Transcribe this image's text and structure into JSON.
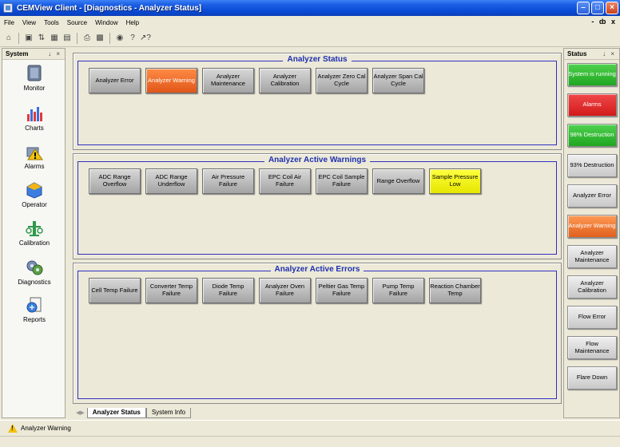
{
  "window": {
    "title": "CEMView Client - [Diagnostics - Analyzer Status]",
    "controls": [
      "minimize",
      "maximize",
      "close"
    ]
  },
  "menu": {
    "items": [
      "File",
      "View",
      "Tools",
      "Source",
      "Window",
      "Help"
    ],
    "mdi_controls": "- ȸ x"
  },
  "toolbar": {
    "icons": [
      "home-icon",
      "window-icon",
      "sort-icon",
      "grid-icon",
      "grid-alt-icon",
      "printer-icon",
      "chart-icon",
      "binoculars-icon",
      "help-icon",
      "whats-this-icon"
    ]
  },
  "system_panel": {
    "title": "System",
    "pin": "↓ ×",
    "items": [
      {
        "label": "Monitor",
        "icon": "monitor-icon"
      },
      {
        "label": "Charts",
        "icon": "charts-icon"
      },
      {
        "label": "Alarms",
        "icon": "alarms-icon"
      },
      {
        "label": "Operator",
        "icon": "operator-icon"
      },
      {
        "label": "Calibration",
        "icon": "calibration-icon"
      },
      {
        "label": "Diagnostics",
        "icon": "diagnostics-icon"
      },
      {
        "label": "Reports",
        "icon": "reports-icon"
      }
    ]
  },
  "status_panel": {
    "title": "Status",
    "pin": "↓ ×",
    "items": [
      {
        "label": "System is running",
        "color": "#2fb82f"
      },
      {
        "label": "Alarms",
        "color": "#e02424"
      },
      {
        "label": "98% Destruction",
        "color": "#2fb82f"
      },
      {
        "label": "93% Destruction",
        "color": "#d8d8d8"
      },
      {
        "label": "Analyzer Error",
        "color": "#d8d8d8"
      },
      {
        "label": "Analyzer Warning",
        "color": "#f07030"
      },
      {
        "label": "Analyzer Maintenance",
        "color": "#d8d8d8"
      },
      {
        "label": "Analyzer Calibration",
        "color": "#d8d8d8"
      },
      {
        "label": "Flow Error",
        "color": "#d8d8d8"
      },
      {
        "label": "Flow Maintenance",
        "color": "#d8d8d8"
      },
      {
        "label": "Flare Down",
        "color": "#d8d8d8"
      }
    ]
  },
  "groups": [
    {
      "title": "Analyzer Status",
      "indicators": [
        {
          "label": "Analyzer Error",
          "color": "gray"
        },
        {
          "label": "Analyzer Warning",
          "color": "orange"
        },
        {
          "label": "Analyzer Maintenance",
          "color": "gray"
        },
        {
          "label": "Analyzer Calibration",
          "color": "gray"
        },
        {
          "label": "Analyzer Zero Cal Cycle",
          "color": "gray"
        },
        {
          "label": "Analyzer Span Cal Cycle",
          "color": "gray"
        }
      ]
    },
    {
      "title": "Analyzer Active Warnings",
      "indicators": [
        {
          "label": "ADC Range Overflow",
          "color": "gray"
        },
        {
          "label": "ADC Range Underflow",
          "color": "gray"
        },
        {
          "label": "Air Pressure Failure",
          "color": "gray"
        },
        {
          "label": "EPC Coil Air Failure",
          "color": "gray"
        },
        {
          "label": "EPC Coil Sample Failure",
          "color": "gray"
        },
        {
          "label": "Range Overflow",
          "color": "gray"
        },
        {
          "label": "Sample Pressure Low",
          "color": "yellow"
        }
      ]
    },
    {
      "title": "Analyzer Active Errors",
      "indicators": [
        {
          "label": "Cell Temp Failure",
          "color": "gray"
        },
        {
          "label": "Converter Temp Failure",
          "color": "gray"
        },
        {
          "label": "Diode Temp Failure",
          "color": "gray"
        },
        {
          "label": "Analyzer Oven Failure",
          "color": "gray"
        },
        {
          "label": "Peltier Gas Temp Failure",
          "color": "gray"
        },
        {
          "label": "Pump Temp Failure",
          "color": "gray"
        },
        {
          "label": "Reaction Chamber Temp",
          "color": "gray"
        }
      ]
    }
  ],
  "tabs": [
    {
      "label": "Analyzer Status",
      "active": true
    },
    {
      "label": "System Info",
      "active": false
    }
  ],
  "statusbar": {
    "message": "Analyzer Warning"
  }
}
